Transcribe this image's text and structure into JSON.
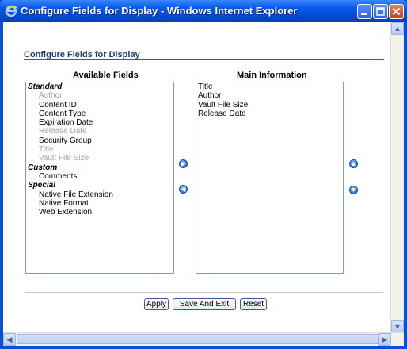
{
  "window": {
    "title": "Configure Fields for Display - Windows Internet Explorer",
    "controls": [
      "minimize",
      "maximize",
      "close"
    ]
  },
  "page": {
    "heading": "Configure Fields for Display"
  },
  "available": {
    "title": "Available Fields",
    "groups": [
      {
        "label": "Standard",
        "items": [
          {
            "label": "Author",
            "disabled": true
          },
          {
            "label": "Content ID",
            "disabled": false
          },
          {
            "label": "Content Type",
            "disabled": false
          },
          {
            "label": "Expiration Date",
            "disabled": false
          },
          {
            "label": "Release Date",
            "disabled": true
          },
          {
            "label": "Security Group",
            "disabled": false
          },
          {
            "label": "Title",
            "disabled": true
          },
          {
            "label": "Vault File Size",
            "disabled": true
          }
        ]
      },
      {
        "label": "Custom",
        "items": [
          {
            "label": "Comments",
            "disabled": false
          }
        ]
      },
      {
        "label": "Special",
        "items": [
          {
            "label": "Native File Extension",
            "disabled": false
          },
          {
            "label": "Native Format",
            "disabled": false
          },
          {
            "label": "Web Extension",
            "disabled": false
          }
        ]
      }
    ]
  },
  "main": {
    "title": "Main Information",
    "items": [
      "Title",
      "Author",
      "Vault File Size",
      "Release Date"
    ]
  },
  "buttons": {
    "apply": "Apply",
    "save_exit": "Save And Exit",
    "reset": "Reset"
  },
  "colors": {
    "titlebar": "#0a5ae8",
    "heading": "#1f3e7c",
    "disabled_text": "#a3a3a3"
  }
}
